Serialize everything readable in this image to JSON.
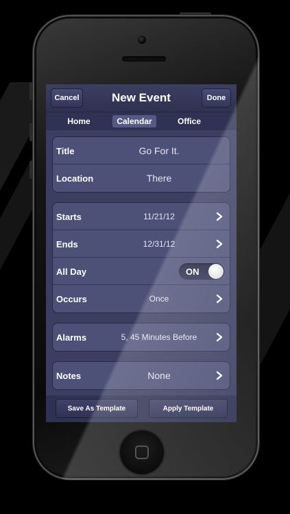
{
  "navbar": {
    "cancel_label": "Cancel",
    "title": "New Event",
    "done_label": "Done"
  },
  "segments": [
    {
      "label": "Home",
      "selected": false
    },
    {
      "label": "Calendar",
      "selected": true
    },
    {
      "label": "Office",
      "selected": false
    }
  ],
  "event": {
    "title_label": "Title",
    "title_value": "Go For It.",
    "location_label": "Location",
    "location_value": "There",
    "starts_label": "Starts",
    "starts_value": "11/21/12",
    "ends_label": "Ends",
    "ends_value": "12/31/12",
    "allday_label": "All Day",
    "allday_toggle": "ON",
    "occurs_label": "Occurs",
    "occurs_value": "Once",
    "alarms_label": "Alarms",
    "alarms_value": "5, 45 Minutes Before",
    "notes_label": "Notes",
    "notes_value": "None"
  },
  "toolbar": {
    "save_template_label": "Save As Template",
    "apply_template_label": "Apply Template"
  },
  "colors": {
    "screen_bg": "#3b3e61",
    "cell_bg": "#4d5177",
    "bar_bg": "#2f3252"
  },
  "icons": [
    "chevron-right-icon",
    "home-button-icon"
  ]
}
